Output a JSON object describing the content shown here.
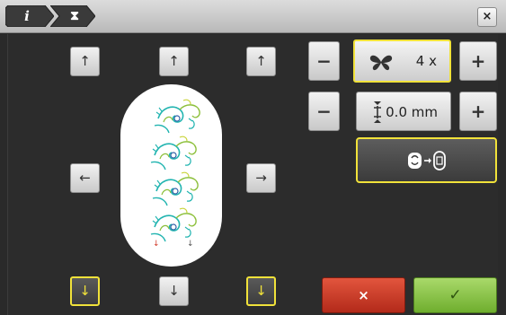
{
  "breadcrumb": {
    "items": [
      {
        "glyph": "i",
        "icon": "info-icon"
      },
      {
        "glyph": "⧗",
        "icon": "repeat-stitch-icon"
      }
    ]
  },
  "window": {
    "close_glyph": "×"
  },
  "move_arrows": {
    "up": "↑",
    "down": "↓",
    "left": "←",
    "right": "→"
  },
  "repeat": {
    "minus": "−",
    "plus": "+",
    "value": "4 x",
    "icon": "butterfly-icon"
  },
  "spacing": {
    "minus": "−",
    "plus": "+",
    "value": "0.0 mm",
    "icon": "vertical-spacing-icon"
  },
  "hoop_action": {
    "icon": "hoop-to-design-icon"
  },
  "footer": {
    "cancel_glyph": "×",
    "confirm_glyph": "✓"
  },
  "colors": {
    "highlight": "#f1e23a",
    "cancel": "#c8361f",
    "confirm": "#8cc63f",
    "motif_teal": "#21b4b0",
    "motif_green": "#8cbf3a",
    "motif_blue": "#2f5fa7"
  }
}
